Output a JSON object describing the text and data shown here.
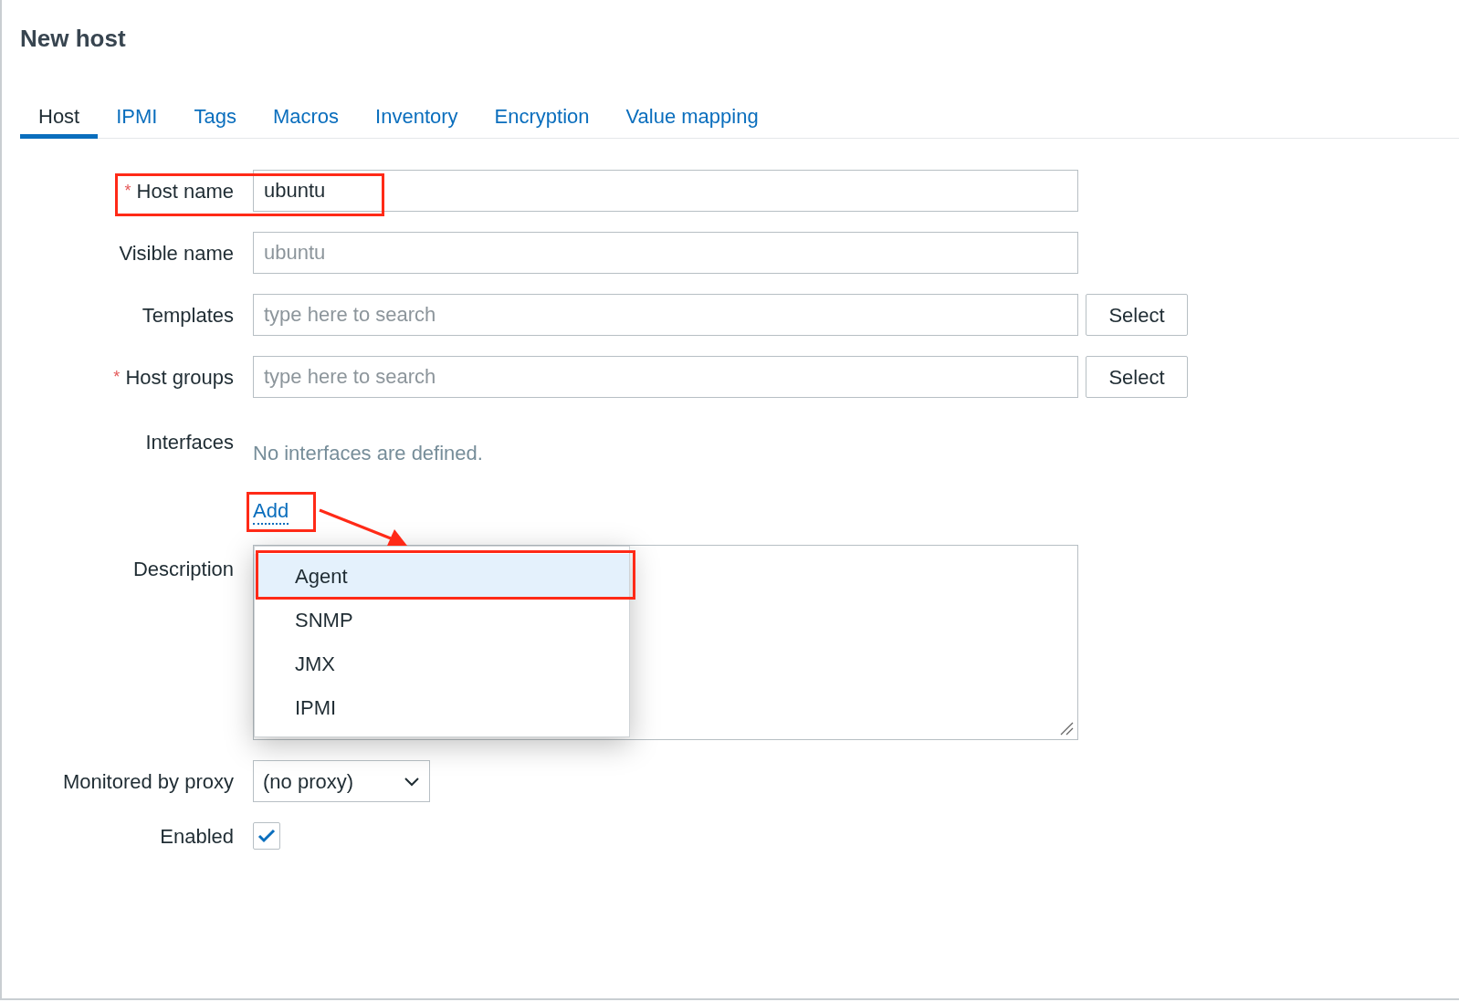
{
  "title": "New host",
  "tabs": [
    {
      "label": "Host",
      "selected": true
    },
    {
      "label": "IPMI",
      "selected": false
    },
    {
      "label": "Tags",
      "selected": false
    },
    {
      "label": "Macros",
      "selected": false
    },
    {
      "label": "Inventory",
      "selected": false
    },
    {
      "label": "Encryption",
      "selected": false
    },
    {
      "label": "Value mapping",
      "selected": false
    }
  ],
  "fields": [
    {
      "kind": "text",
      "label": "Host name",
      "marker": "*",
      "value": "ubuntu"
    },
    {
      "kind": "text",
      "label": "Visible name",
      "placeholder": "ubuntu"
    },
    {
      "kind": "multiselect",
      "label": "Templates",
      "placeholder": "type here to search",
      "button": "Select"
    },
    {
      "kind": "multiselect",
      "label": "Host groups",
      "marker": "*",
      "placeholder": "type here to search",
      "button": "Select"
    },
    {
      "kind": "interfaces",
      "label": "Interfaces",
      "message": "No interfaces are defined.",
      "link": "Add"
    },
    {
      "kind": "textarea",
      "label": "Description"
    },
    {
      "kind": "select",
      "label": "Monitored by proxy",
      "value": "(no proxy)"
    },
    {
      "kind": "checkbox",
      "label": "Enabled",
      "checked": true
    }
  ],
  "menu": {
    "items": [
      {
        "label": "Agent",
        "selected": true
      },
      {
        "label": "SNMP",
        "selected": false
      },
      {
        "label": "JMX",
        "selected": false
      },
      {
        "label": "IPMI",
        "selected": false
      }
    ]
  }
}
